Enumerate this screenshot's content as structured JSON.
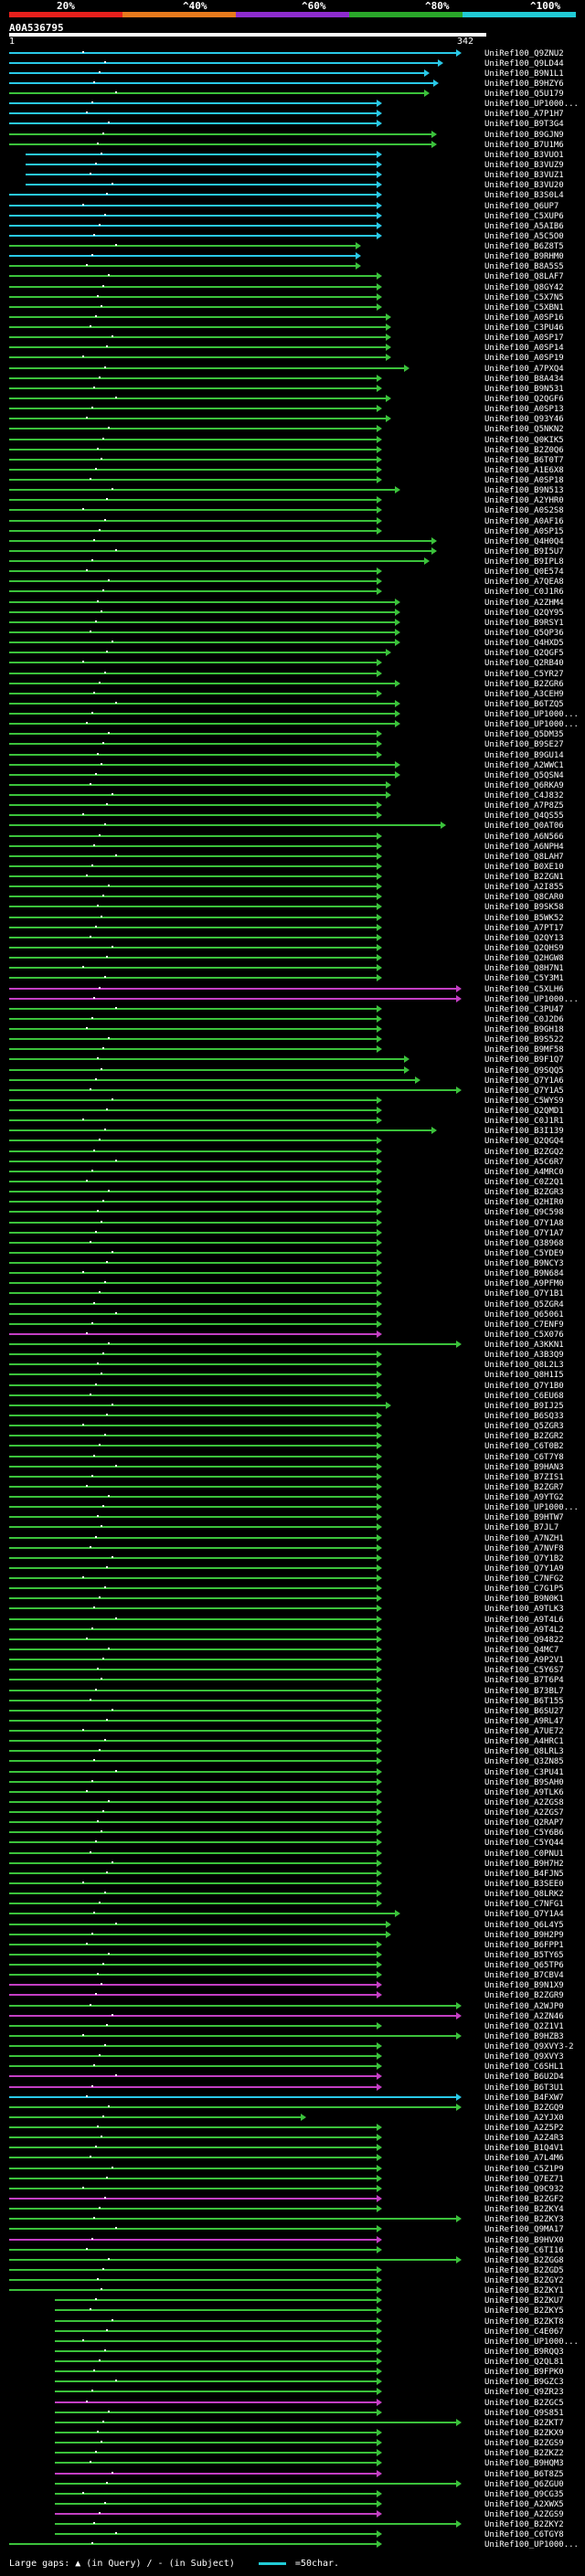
{
  "scale": {
    "labels": [
      "20%",
      "^40%",
      "^60%",
      "^80%",
      "^100%"
    ],
    "colors": [
      "#e8201c",
      "#e87a1c",
      "#8e2ccf",
      "#2aa82a",
      "#21cbd6"
    ]
  },
  "query": {
    "id": "A0A536795",
    "start": "1",
    "end": "342"
  },
  "colors": {
    "cyan": "#29c9e8",
    "green": "#3bc23b",
    "magenta": "#c43ec4",
    "background": "#000000"
  },
  "hits": [
    {
      "id": "UniRef100_Q9ZNU2",
      "color": "cyan"
    },
    {
      "id": "UniRef100_Q9LD44",
      "color": "cyan"
    },
    {
      "id": "UniRef100_B9N1L1",
      "color": "cyan"
    },
    {
      "id": "UniRef100_B9HZY6",
      "color": "cyan"
    },
    {
      "id": "UniRef100_Q5U179",
      "color": "green"
    },
    {
      "id": "UniRef100_UP1000...",
      "color": "cyan"
    },
    {
      "id": "UniRef100_A7P1H7",
      "color": "cyan"
    },
    {
      "id": "UniRef100_B9T3G4",
      "color": "cyan"
    },
    {
      "id": "UniRef100_B9GJN9",
      "color": "green"
    },
    {
      "id": "UniRef100_B7U1M6",
      "color": "green"
    },
    {
      "id": "UniRef100_B3VUO1",
      "color": "cyan"
    },
    {
      "id": "UniRef100_B3VUZ9",
      "color": "cyan"
    },
    {
      "id": "UniRef100_B3VUZ1",
      "color": "cyan"
    },
    {
      "id": "UniRef100_B3VU20",
      "color": "cyan"
    },
    {
      "id": "UniRef100_B3S0L4",
      "color": "cyan"
    },
    {
      "id": "UniRef100_Q6UP7",
      "color": "cyan"
    },
    {
      "id": "UniRef100_C5XUP6",
      "color": "cyan"
    },
    {
      "id": "UniRef100_A5AIB6",
      "color": "cyan"
    },
    {
      "id": "UniRef100_A5C5O0",
      "color": "cyan"
    },
    {
      "id": "UniRef100_B6Z8T5",
      "color": "green"
    },
    {
      "id": "UniRef100_B9RHM0",
      "color": "cyan"
    },
    {
      "id": "UniRef100_B8A5S5",
      "color": "green"
    },
    {
      "id": "UniRef100_Q8LAF7",
      "color": "green"
    },
    {
      "id": "UniRef100_Q8GY42",
      "color": "green"
    },
    {
      "id": "UniRef100_C5X7N5",
      "color": "green"
    },
    {
      "id": "UniRef100_C5XBN1",
      "color": "green"
    },
    {
      "id": "UniRef100_A0SP16",
      "color": "green"
    },
    {
      "id": "UniRef100_C3PU46",
      "color": "green"
    },
    {
      "id": "UniRef100_A0SP17",
      "color": "green"
    },
    {
      "id": "UniRef100_A0SP14",
      "color": "green"
    },
    {
      "id": "UniRef100_A0SP19",
      "color": "green"
    },
    {
      "id": "UniRef100_A7PXQ4",
      "color": "green"
    },
    {
      "id": "UniRef100_B8A434",
      "color": "green"
    },
    {
      "id": "UniRef100_B9N531",
      "color": "green"
    },
    {
      "id": "UniRef100_Q2QGF6",
      "color": "green"
    },
    {
      "id": "UniRef100_A0SP13",
      "color": "green"
    },
    {
      "id": "UniRef100_Q93Y46",
      "color": "green"
    },
    {
      "id": "UniRef100_Q5NKN2",
      "color": "green"
    },
    {
      "id": "UniRef100_Q0KIK5",
      "color": "green"
    },
    {
      "id": "UniRef100_B2Z0Q6",
      "color": "green"
    },
    {
      "id": "UniRef100_B6T0T7",
      "color": "green"
    },
    {
      "id": "UniRef100_A1E6X8",
      "color": "green"
    },
    {
      "id": "UniRef100_A0SP18",
      "color": "green"
    },
    {
      "id": "UniRef100_B9N513",
      "color": "green"
    },
    {
      "id": "UniRef100_A2YHR0",
      "color": "green"
    },
    {
      "id": "UniRef100_A0S2S8",
      "color": "green"
    },
    {
      "id": "UniRef100_A0AF16",
      "color": "green"
    },
    {
      "id": "UniRef100_A0SP15",
      "color": "green"
    },
    {
      "id": "UniRef100_Q4H0Q4",
      "color": "green"
    },
    {
      "id": "UniRef100_B9I5U7",
      "color": "green"
    },
    {
      "id": "UniRef100_B9IPL8",
      "color": "green"
    },
    {
      "id": "UniRef100_Q0E574",
      "color": "green"
    },
    {
      "id": "UniRef100_A7QEA8",
      "color": "green"
    },
    {
      "id": "UniRef100_C0J1R6",
      "color": "green"
    },
    {
      "id": "UniRef100_A2ZHM4",
      "color": "green"
    },
    {
      "id": "UniRef100_Q2QY95",
      "color": "green"
    },
    {
      "id": "UniRef100_B9RSY1",
      "color": "green"
    },
    {
      "id": "UniRef100_Q5QP36",
      "color": "green"
    },
    {
      "id": "UniRef100_Q4HXD5",
      "color": "green"
    },
    {
      "id": "UniRef100_Q2QGF5",
      "color": "green"
    },
    {
      "id": "UniRef100_Q2RB40",
      "color": "green"
    },
    {
      "id": "UniRef100_C5YR27",
      "color": "green"
    },
    {
      "id": "UniRef100_B2ZGR6",
      "color": "green"
    },
    {
      "id": "UniRef100_A3CEH9",
      "color": "green"
    },
    {
      "id": "UniRef100_B6TZQ5",
      "color": "green"
    },
    {
      "id": "UniRef100_UP1000...",
      "color": "green"
    },
    {
      "id": "UniRef100_UP1000...",
      "color": "green"
    },
    {
      "id": "UniRef100_Q5DM35",
      "color": "green"
    },
    {
      "id": "UniRef100_B9SE27",
      "color": "green"
    },
    {
      "id": "UniRef100_B9GU14",
      "color": "green"
    },
    {
      "id": "UniRef100_A2WWC1",
      "color": "green"
    },
    {
      "id": "UniRef100_Q5QSN4",
      "color": "green"
    },
    {
      "id": "UniRef100_Q6RKA9",
      "color": "green"
    },
    {
      "id": "UniRef100_C4J832",
      "color": "green"
    },
    {
      "id": "UniRef100_A7P8Z5",
      "color": "green"
    },
    {
      "id": "UniRef100_Q4QS55",
      "color": "green"
    },
    {
      "id": "UniRef100_Q0AT06",
      "color": "green"
    },
    {
      "id": "UniRef100_A6N566",
      "color": "green"
    },
    {
      "id": "UniRef100_A6NPH4",
      "color": "green"
    },
    {
      "id": "UniRef100_Q8LAH7",
      "color": "green"
    },
    {
      "id": "UniRef100_B0XE10",
      "color": "green"
    },
    {
      "id": "UniRef100_B2ZGN1",
      "color": "green"
    },
    {
      "id": "UniRef100_A2I855",
      "color": "green"
    },
    {
      "id": "UniRef100_Q8CAR0",
      "color": "green"
    },
    {
      "id": "UniRef100_B9SK58",
      "color": "green"
    },
    {
      "id": "UniRef100_B5WK52",
      "color": "green"
    },
    {
      "id": "UniRef100_A7PT17",
      "color": "green"
    },
    {
      "id": "UniRef100_Q2QY13",
      "color": "green"
    },
    {
      "id": "UniRef100_Q2QHS9",
      "color": "green"
    },
    {
      "id": "UniRef100_Q2HGW8",
      "color": "green"
    },
    {
      "id": "UniRef100_Q8H7N1",
      "color": "green"
    },
    {
      "id": "UniRef100_C5Y3M1",
      "color": "green"
    },
    {
      "id": "UniRef100_C5XLH6",
      "color": "magenta"
    },
    {
      "id": "UniRef100_UP1000...",
      "color": "magenta"
    },
    {
      "id": "UniRef100_C3PU47",
      "color": "green"
    },
    {
      "id": "UniRef100_C0J2D6",
      "color": "green"
    },
    {
      "id": "UniRef100_B9GH18",
      "color": "green"
    },
    {
      "id": "UniRef100_B9S522",
      "color": "green"
    },
    {
      "id": "UniRef100_B9MF58",
      "color": "green"
    },
    {
      "id": "UniRef100_B9F1Q7",
      "color": "green"
    },
    {
      "id": "UniRef100_Q9SQQ5",
      "color": "green"
    },
    {
      "id": "UniRef100_Q7Y1A6",
      "color": "green"
    },
    {
      "id": "UniRef100_Q7Y1A5",
      "color": "green"
    },
    {
      "id": "UniRef100_C5WYS9",
      "color": "green"
    },
    {
      "id": "UniRef100_Q2QMD1",
      "color": "green"
    },
    {
      "id": "UniRef100_C0J1R1",
      "color": "green"
    },
    {
      "id": "UniRef100_B3I139",
      "color": "green"
    },
    {
      "id": "UniRef100_Q2QGQ4",
      "color": "green"
    },
    {
      "id": "UniRef100_B2ZGQ2",
      "color": "green"
    },
    {
      "id": "UniRef100_A5C6R7",
      "color": "green"
    },
    {
      "id": "UniRef100_A4MRC0",
      "color": "green"
    },
    {
      "id": "UniRef100_C0Z2Q1",
      "color": "green"
    },
    {
      "id": "UniRef100_B2ZGR3",
      "color": "green"
    },
    {
      "id": "UniRef100_Q2HIR0",
      "color": "green"
    },
    {
      "id": "UniRef100_Q9C598",
      "color": "green"
    },
    {
      "id": "UniRef100_Q7Y1A8",
      "color": "green"
    },
    {
      "id": "UniRef100_Q7Y1A7",
      "color": "green"
    },
    {
      "id": "UniRef100_Q38968",
      "color": "green"
    },
    {
      "id": "UniRef100_C5YDE9",
      "color": "green"
    },
    {
      "id": "UniRef100_B9NCY3",
      "color": "green"
    },
    {
      "id": "UniRef100_B9N684",
      "color": "green"
    },
    {
      "id": "UniRef100_A9PFM0",
      "color": "green"
    },
    {
      "id": "UniRef100_Q7Y1B1",
      "color": "green"
    },
    {
      "id": "UniRef100_Q5ZGR4",
      "color": "green"
    },
    {
      "id": "UniRef100_Q65061",
      "color": "green"
    },
    {
      "id": "UniRef100_C7ENF9",
      "color": "green"
    },
    {
      "id": "UniRef100_C5X076",
      "color": "magenta"
    },
    {
      "id": "UniRef100_A3KKN1",
      "color": "green"
    },
    {
      "id": "UniRef100_A3B3Q9",
      "color": "green"
    },
    {
      "id": "UniRef100_Q8L2L3",
      "color": "green"
    },
    {
      "id": "UniRef100_Q8H1I5",
      "color": "green"
    },
    {
      "id": "UniRef100_Q7Y1B0",
      "color": "green"
    },
    {
      "id": "UniRef100_C6EU68",
      "color": "green"
    },
    {
      "id": "UniRef100_B9IJ25",
      "color": "green"
    },
    {
      "id": "UniRef100_B6SQ33",
      "color": "green"
    },
    {
      "id": "UniRef100_Q5ZGR3",
      "color": "green"
    },
    {
      "id": "UniRef100_B2ZGR2",
      "color": "green"
    },
    {
      "id": "UniRef100_C6T0B2",
      "color": "green"
    },
    {
      "id": "UniRef100_C6T7Y8",
      "color": "green"
    },
    {
      "id": "UniRef100_B9HAN3",
      "color": "green"
    },
    {
      "id": "UniRef100_B7ZIS1",
      "color": "green"
    },
    {
      "id": "UniRef100_B2ZGR7",
      "color": "green"
    },
    {
      "id": "UniRef100_A9YTG2",
      "color": "green"
    },
    {
      "id": "UniRef100_UP1000...",
      "color": "green"
    },
    {
      "id": "UniRef100_B9HTW7",
      "color": "green"
    },
    {
      "id": "UniRef100_B7JL7",
      "color": "green"
    },
    {
      "id": "UniRef100_A7NZH1",
      "color": "green"
    },
    {
      "id": "UniRef100_A7NVF8",
      "color": "green"
    },
    {
      "id": "UniRef100_Q7Y1B2",
      "color": "green"
    },
    {
      "id": "UniRef100_Q7Y1A9",
      "color": "green"
    },
    {
      "id": "UniRef100_C7NFG2",
      "color": "green"
    },
    {
      "id": "UniRef100_C7G1P5",
      "color": "green"
    },
    {
      "id": "UniRef100_B9N0K1",
      "color": "green"
    },
    {
      "id": "UniRef100_A9TLK3",
      "color": "green"
    },
    {
      "id": "UniRef100_A9T4L6",
      "color": "green"
    },
    {
      "id": "UniRef100_A9T4L2",
      "color": "green"
    },
    {
      "id": "UniRef100_Q94822",
      "color": "green"
    },
    {
      "id": "UniRef100_Q4MC7",
      "color": "green"
    },
    {
      "id": "UniRef100_A9P2V1",
      "color": "green"
    },
    {
      "id": "UniRef100_C5Y6S7",
      "color": "green"
    },
    {
      "id": "UniRef100_B7T6P4",
      "color": "green"
    },
    {
      "id": "UniRef100_B73BL7",
      "color": "green"
    },
    {
      "id": "UniRef100_B6T155",
      "color": "green"
    },
    {
      "id": "UniRef100_B6SU27",
      "color": "green"
    },
    {
      "id": "UniRef100_A9RL47",
      "color": "green"
    },
    {
      "id": "UniRef100_A7UE72",
      "color": "green"
    },
    {
      "id": "UniRef100_A4HRC1",
      "color": "green"
    },
    {
      "id": "UniRef100_Q8LRL3",
      "color": "green"
    },
    {
      "id": "UniRef100_Q3ZN85",
      "color": "green"
    },
    {
      "id": "UniRef100_C3PU41",
      "color": "green"
    },
    {
      "id": "UniRef100_B9SAH0",
      "color": "green"
    },
    {
      "id": "UniRef100_A9TLK6",
      "color": "green"
    },
    {
      "id": "UniRef100_A2ZGS8",
      "color": "green"
    },
    {
      "id": "UniRef100_A2ZGS7",
      "color": "green"
    },
    {
      "id": "UniRef100_Q2RAP7",
      "color": "green"
    },
    {
      "id": "UniRef100_C5Y6B6",
      "color": "green"
    },
    {
      "id": "UniRef100_C5YQ44",
      "color": "green"
    },
    {
      "id": "UniRef100_C0PNU1",
      "color": "green"
    },
    {
      "id": "UniRef100_B9H7H2",
      "color": "green"
    },
    {
      "id": "UniRef100_B4FJN5",
      "color": "green"
    },
    {
      "id": "UniRef100_B3SEE0",
      "color": "green"
    },
    {
      "id": "UniRef100_Q8LRK2",
      "color": "green"
    },
    {
      "id": "UniRef100_C7NFG1",
      "color": "green"
    },
    {
      "id": "UniRef100_Q7Y1A4",
      "color": "green"
    },
    {
      "id": "UniRef100_Q6L4Y5",
      "color": "green"
    },
    {
      "id": "UniRef100_B9H2P9",
      "color": "green"
    },
    {
      "id": "UniRef100_B6FPP1",
      "color": "green"
    },
    {
      "id": "UniRef100_B5TY65",
      "color": "green"
    },
    {
      "id": "UniRef100_Q65TP6",
      "color": "green"
    },
    {
      "id": "UniRef100_B7CBV4",
      "color": "green"
    },
    {
      "id": "UniRef100_B9N1X9",
      "color": "magenta"
    },
    {
      "id": "UniRef100_B2ZGR9",
      "color": "magenta"
    },
    {
      "id": "UniRef100_A2WJP0",
      "color": "green"
    },
    {
      "id": "UniRef100_A2ZN46",
      "color": "magenta"
    },
    {
      "id": "UniRef100_Q2Z1V1",
      "color": "green"
    },
    {
      "id": "UniRef100_B9HZB3",
      "color": "green"
    },
    {
      "id": "UniRef100_Q9XVY3-2",
      "color": "green"
    },
    {
      "id": "UniRef100_Q9XVY3",
      "color": "green"
    },
    {
      "id": "UniRef100_C6SHL1",
      "color": "green"
    },
    {
      "id": "UniRef100_B6U2D4",
      "color": "magenta"
    },
    {
      "id": "UniRef100_B6T3U1",
      "color": "magenta"
    },
    {
      "id": "UniRef100_B4FXW7",
      "color": "cyan"
    },
    {
      "id": "UniRef100_B2ZGQ9",
      "color": "green"
    },
    {
      "id": "UniRef100_A2YJX0",
      "color": "green"
    },
    {
      "id": "UniRef100_A2Z5P2",
      "color": "green"
    },
    {
      "id": "UniRef100_A2Z4R3",
      "color": "green"
    },
    {
      "id": "UniRef100_B1Q4V1",
      "color": "green"
    },
    {
      "id": "UniRef100_A7L4M6",
      "color": "green"
    },
    {
      "id": "UniRef100_C5Z1P9",
      "color": "green"
    },
    {
      "id": "UniRef100_Q7EZ71",
      "color": "green"
    },
    {
      "id": "UniRef100_Q9C932",
      "color": "green"
    },
    {
      "id": "UniRef100_B2ZGF2",
      "color": "magenta"
    },
    {
      "id": "UniRef100_B2ZKY4",
      "color": "green"
    },
    {
      "id": "UniRef100_B2ZKY3",
      "color": "green"
    },
    {
      "id": "UniRef100_Q9MA17",
      "color": "green"
    },
    {
      "id": "UniRef100_B9HVX0",
      "color": "magenta"
    },
    {
      "id": "UniRef100_C6TI16",
      "color": "green"
    },
    {
      "id": "UniRef100_B2ZGG8",
      "color": "green"
    },
    {
      "id": "UniRef100_B2ZGD5",
      "color": "green"
    },
    {
      "id": "UniRef100_B2ZGY2",
      "color": "green"
    },
    {
      "id": "UniRef100_B2ZKY1",
      "color": "green"
    },
    {
      "id": "UniRef100_B2ZKU7",
      "color": "green"
    },
    {
      "id": "UniRef100_B2ZKY5",
      "color": "green"
    },
    {
      "id": "UniRef100_B2ZKT8",
      "color": "green"
    },
    {
      "id": "UniRef100_C4E067",
      "color": "green"
    },
    {
      "id": "UniRef100_UP1000...",
      "color": "green"
    },
    {
      "id": "UniRef100_B9RQQ3",
      "color": "green"
    },
    {
      "id": "UniRef100_Q2QL81",
      "color": "green"
    },
    {
      "id": "UniRef100_B9FPK0",
      "color": "green"
    },
    {
      "id": "UniRef100_B9GZC3",
      "color": "green"
    },
    {
      "id": "UniRef100_Q9ZR23",
      "color": "green"
    },
    {
      "id": "UniRef100_B2ZGC5",
      "color": "magenta"
    },
    {
      "id": "UniRef100_Q9S851",
      "color": "green"
    },
    {
      "id": "UniRef100_B2ZKT7",
      "color": "green"
    },
    {
      "id": "UniRef100_B2ZKX9",
      "color": "green"
    },
    {
      "id": "UniRef100_B2ZGS9",
      "color": "green"
    },
    {
      "id": "UniRef100_B2ZKZ2",
      "color": "green"
    },
    {
      "id": "UniRef100_B9HQM3",
      "color": "green"
    },
    {
      "id": "UniRef100_B6T8Z5",
      "color": "magenta"
    },
    {
      "id": "UniRef100_Q6ZGU0",
      "color": "green"
    },
    {
      "id": "UniRef100_Q9CG35",
      "color": "green"
    },
    {
      "id": "UniRef100_A2XWX5",
      "color": "green"
    },
    {
      "id": "UniRef100_A2ZGS9",
      "color": "magenta"
    },
    {
      "id": "UniRef100_B2ZKY2",
      "color": "green"
    },
    {
      "id": "UniRef100_C6TGY8",
      "color": "green"
    },
    {
      "id": "UniRef100_UP1000...",
      "color": "green"
    }
  ],
  "legend": {
    "gaps_text": "Large gaps: ▲ (in Query) / - (in Subject)",
    "scale_text": "=50char."
  }
}
